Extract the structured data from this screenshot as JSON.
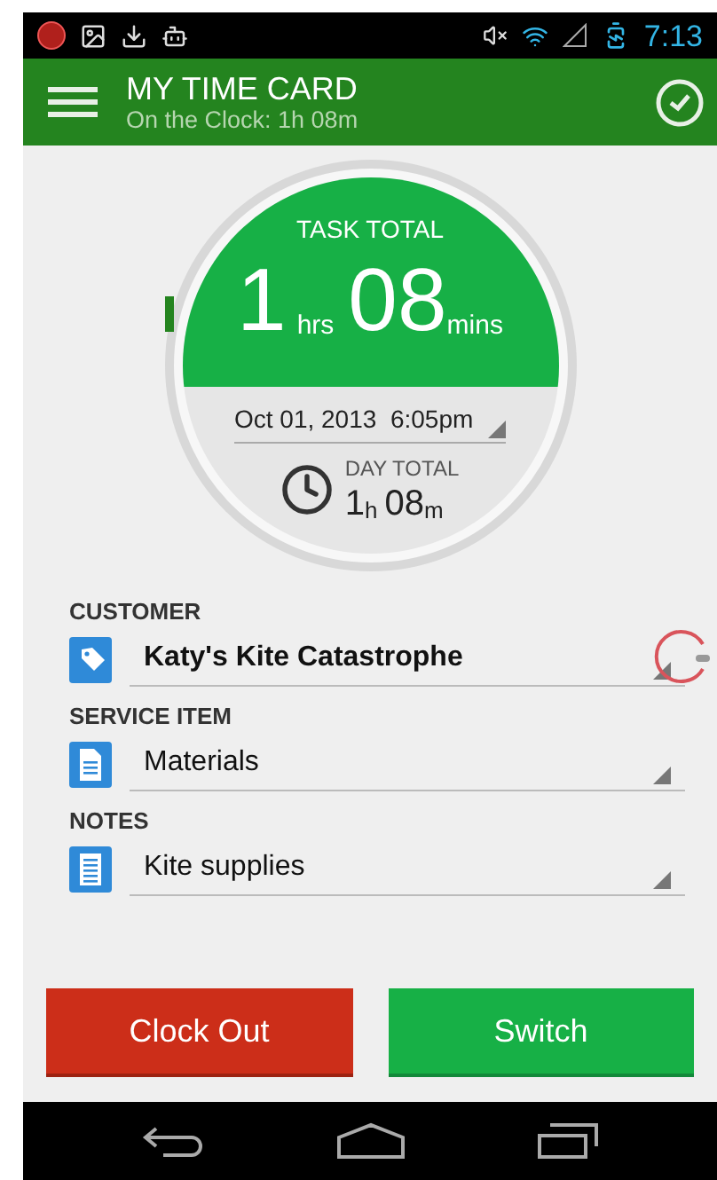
{
  "status_bar": {
    "time": "7:13"
  },
  "app_bar": {
    "title": "MY TIME CARD",
    "subtitle": "On the Clock: 1h 08m"
  },
  "task_total": {
    "label": "TASK TOTAL",
    "hours": "1",
    "hours_unit": "hrs",
    "minutes": "08",
    "minutes_unit": "mins"
  },
  "start": {
    "value": "Oct 01, 2013  6:05pm"
  },
  "day_total": {
    "label": "DAY TOTAL",
    "hours": "1",
    "hours_unit": "h",
    "minutes": "08",
    "minutes_unit": "m"
  },
  "fields": [
    {
      "kind": "tag",
      "label": "CUSTOMER",
      "value": "Katy's Kite Catastrophe",
      "emphasized": true,
      "touched": true
    },
    {
      "kind": "document",
      "label": "SERVICE ITEM",
      "value": "Materials",
      "emphasized": false,
      "touched": false
    },
    {
      "kind": "notes",
      "label": "NOTES",
      "value": "Kite supplies",
      "emphasized": false,
      "touched": false
    }
  ],
  "buttons": [
    {
      "label": "Clock Out",
      "kind": "danger"
    },
    {
      "label": "Switch",
      "kind": "primary"
    }
  ]
}
